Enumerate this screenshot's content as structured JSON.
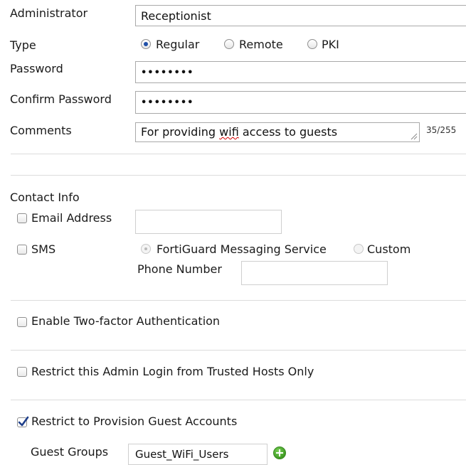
{
  "administrator": {
    "label": "Administrator",
    "value": "Receptionist"
  },
  "type": {
    "label": "Type",
    "options": [
      {
        "label": "Regular",
        "selected": true
      },
      {
        "label": "Remote",
        "selected": false
      },
      {
        "label": "PKI",
        "selected": false
      }
    ]
  },
  "password": {
    "label": "Password",
    "value": "••••••••"
  },
  "confirm_password": {
    "label": "Confirm Password",
    "value": "••••••••"
  },
  "comments": {
    "label": "Comments",
    "value_before": "For providing ",
    "value_misspelled": "wifi",
    "value_after": " access to guests",
    "counter": "35/255"
  },
  "contact_info": {
    "heading": "Contact Info",
    "email": {
      "label": "Email Address",
      "checked": false,
      "value": ""
    },
    "sms": {
      "label": "SMS",
      "checked": false,
      "options": [
        {
          "label": "FortiGuard Messaging Service",
          "selected": true
        },
        {
          "label": "Custom",
          "selected": false
        }
      ],
      "phone_label": "Phone Number",
      "phone_value": ""
    }
  },
  "two_factor": {
    "label": "Enable Two-factor Authentication",
    "checked": false
  },
  "trusted_hosts": {
    "label": "Restrict this Admin Login from Trusted Hosts Only",
    "checked": false
  },
  "guest_accounts": {
    "label": "Restrict to Provision Guest Accounts",
    "checked": true,
    "groups_label": "Guest Groups",
    "group_value": "Guest_WiFi_Users"
  },
  "colors": {
    "accent": "#1f4fa8",
    "add_icon": "#4caf2a"
  }
}
